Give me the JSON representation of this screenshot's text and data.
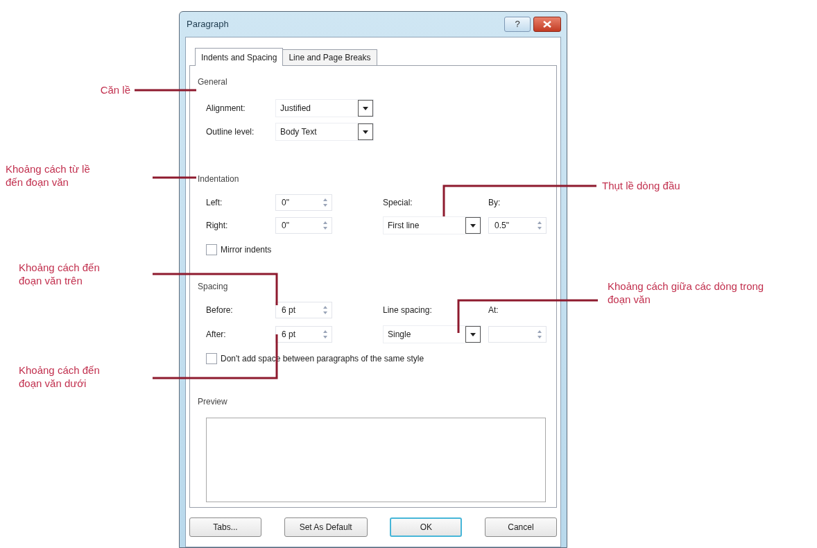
{
  "dialog": {
    "title": "Paragraph",
    "help_button": "?"
  },
  "tabs": [
    {
      "label": "Indents and Spacing",
      "selected": true
    },
    {
      "label": "Line and Page Breaks",
      "selected": false
    }
  ],
  "general": {
    "heading": "General",
    "alignment": {
      "label": "Alignment:",
      "value": "Justified"
    },
    "outline_level": {
      "label": "Outline level:",
      "value": "Body Text"
    }
  },
  "indentation": {
    "heading": "Indentation",
    "left": {
      "label": "Left:",
      "value": "0\""
    },
    "right": {
      "label": "Right:",
      "value": "0\""
    },
    "special": {
      "label": "Special:",
      "value": "First line"
    },
    "by": {
      "label": "By:",
      "value": "0.5\""
    },
    "mirror": {
      "label": "Mirror indents",
      "checked": false
    }
  },
  "spacing": {
    "heading": "Spacing",
    "before": {
      "label": "Before:",
      "value": "6 pt"
    },
    "after": {
      "label": "After:",
      "value": "6 pt"
    },
    "line_spacing": {
      "label": "Line spacing:",
      "value": "Single"
    },
    "at": {
      "label": "At:"
    },
    "dont_add": {
      "label": "Don't add space between paragraphs of the same style",
      "checked": false
    }
  },
  "preview": {
    "heading": "Preview"
  },
  "buttons": [
    {
      "label": "Tabs...",
      "default": false
    },
    {
      "label": "Set As Default",
      "default": false
    },
    {
      "label": "OK",
      "default": true
    },
    {
      "label": "Cancel",
      "default": false
    }
  ],
  "annotations": [
    {
      "text": "Căn lề"
    },
    {
      "text": "Khoảng cách từ lề đến đoạn văn"
    },
    {
      "text": "Thụt lề dòng đầu"
    },
    {
      "text": "Khoảng cách đến đoạn văn trên"
    },
    {
      "text": "Khoảng cách giữa các dòng trong đoạn văn"
    },
    {
      "text": "Khoảng cách đến đoạn văn dưới"
    }
  ]
}
